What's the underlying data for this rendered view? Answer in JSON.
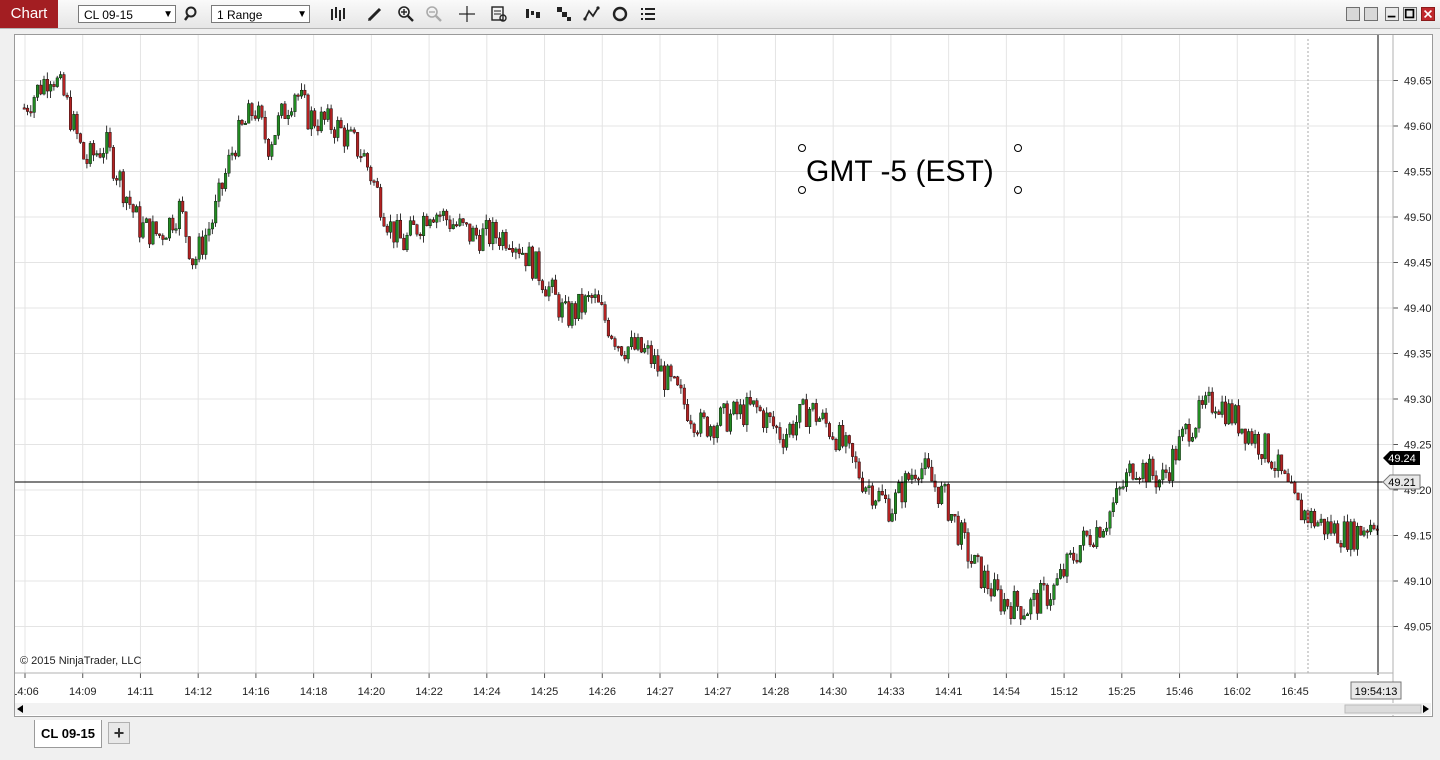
{
  "toolbar": {
    "chart_label": "Chart",
    "instrument": "CL 09-15",
    "bar_type": "1 Range",
    "icons": [
      "search-icon",
      "bar-style-icon",
      "pencil-icon",
      "zoom-in-icon",
      "zoom-out-icon",
      "crosshair-icon",
      "data-box-icon",
      "strategies-icon",
      "properties-icon",
      "indicators-icon",
      "reload-icon",
      "list-icon"
    ]
  },
  "chart": {
    "annotation_text": "GMT -5  (EST)",
    "copyright": "© 2015 NinjaTrader, LLC",
    "current_price_label": "49.24",
    "crosshair_price_label": "49.21",
    "time_label": "19:54:13",
    "colors": {
      "up_bar": "#228b22",
      "down_bar": "#b22222",
      "grid": "#e4e4e4",
      "frame": "#9a9a9a"
    }
  },
  "chart_data": {
    "type": "candlestick",
    "y_ticks": [
      "49.65",
      "49.60",
      "49.55",
      "49.50",
      "49.45",
      "49.40",
      "49.35",
      "49.30",
      "49.25",
      "49.20",
      "49.15",
      "49.10",
      "49.05"
    ],
    "x_ticks": [
      "14:06",
      "14:09",
      "14:11",
      "14:12",
      "14:16",
      "14:18",
      "14:20",
      "14:22",
      "14:24",
      "14:25",
      "14:26",
      "14:27",
      "14:27",
      "14:28",
      "14:30",
      "14:33",
      "14:41",
      "14:54",
      "15:12",
      "15:25",
      "15:46",
      "16:02",
      "16:45"
    ],
    "ylim": [
      49.0,
      49.7
    ],
    "price_path": [
      [
        0,
        49.62
      ],
      [
        0.02,
        49.66
      ],
      [
        0.03,
        49.63
      ],
      [
        0.045,
        49.56
      ],
      [
        0.06,
        49.58
      ],
      [
        0.085,
        49.49
      ],
      [
        0.1,
        49.48
      ],
      [
        0.115,
        49.51
      ],
      [
        0.125,
        49.45
      ],
      [
        0.14,
        49.5
      ],
      [
        0.155,
        49.58
      ],
      [
        0.17,
        49.62
      ],
      [
        0.18,
        49.58
      ],
      [
        0.2,
        49.64
      ],
      [
        0.21,
        49.61
      ],
      [
        0.23,
        49.6
      ],
      [
        0.25,
        49.57
      ],
      [
        0.27,
        49.49
      ],
      [
        0.28,
        49.47
      ],
      [
        0.3,
        49.51
      ],
      [
        0.33,
        49.48
      ],
      [
        0.36,
        49.48
      ],
      [
        0.38,
        49.44
      ],
      [
        0.4,
        49.39
      ],
      [
        0.42,
        49.41
      ],
      [
        0.44,
        49.36
      ],
      [
        0.46,
        49.35
      ],
      [
        0.48,
        49.31
      ],
      [
        0.5,
        49.27
      ],
      [
        0.52,
        49.28
      ],
      [
        0.54,
        49.29
      ],
      [
        0.56,
        49.26
      ],
      [
        0.58,
        49.29
      ],
      [
        0.6,
        49.26
      ],
      [
        0.62,
        49.21
      ],
      [
        0.64,
        49.18
      ],
      [
        0.66,
        49.23
      ],
      [
        0.68,
        49.19
      ],
      [
        0.7,
        49.12
      ],
      [
        0.72,
        49.08
      ],
      [
        0.74,
        49.07
      ],
      [
        0.76,
        49.09
      ],
      [
        0.78,
        49.14
      ],
      [
        0.8,
        49.17
      ],
      [
        0.82,
        49.23
      ],
      [
        0.84,
        49.21
      ],
      [
        0.86,
        49.27
      ],
      [
        0.88,
        49.3
      ],
      [
        0.9,
        49.27
      ],
      [
        0.92,
        49.24
      ],
      [
        0.94,
        49.18
      ],
      [
        0.96,
        49.16
      ],
      [
        0.98,
        49.15
      ],
      [
        1.0,
        49.17
      ]
    ]
  },
  "tabs": {
    "active_tab": "CL 09-15",
    "add_tab_label": "+"
  }
}
